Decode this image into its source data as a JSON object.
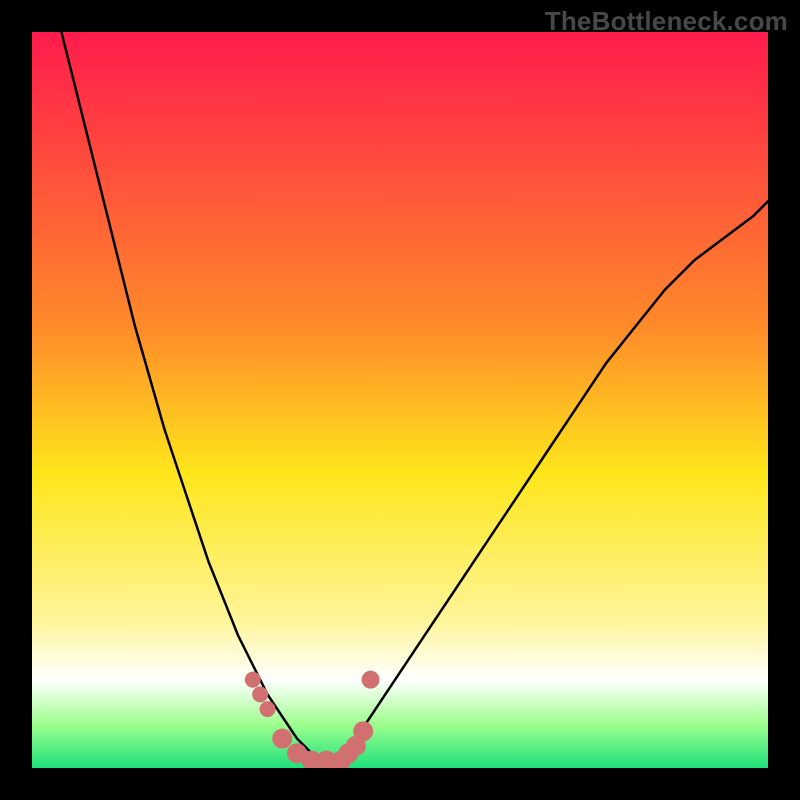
{
  "watermark": "TheBottleneck.com",
  "chart_data": {
    "type": "line",
    "title": "",
    "xlabel": "",
    "ylabel": "",
    "xlim": [
      0,
      100
    ],
    "ylim": [
      0,
      100
    ],
    "grid": false,
    "legend": false,
    "background_gradient": {
      "stops": [
        {
          "pos": 0.0,
          "color": "#ff1b4c"
        },
        {
          "pos": 0.4,
          "color": "#ff8a2a"
        },
        {
          "pos": 0.6,
          "color": "#ffe61b"
        },
        {
          "pos": 0.8,
          "color": "#fff59a"
        },
        {
          "pos": 0.88,
          "color": "#ffffff"
        },
        {
          "pos": 0.94,
          "color": "#9fff8f"
        },
        {
          "pos": 1.0,
          "color": "#1ee07a"
        }
      ]
    },
    "series": [
      {
        "name": "curve-left",
        "x": [
          4,
          6,
          8,
          10,
          12,
          14,
          16,
          18,
          20,
          22,
          24,
          26,
          28,
          30,
          32,
          34,
          36,
          38
        ],
        "y": [
          100,
          92,
          84,
          76,
          68,
          60,
          53,
          46,
          40,
          34,
          28,
          23,
          18,
          14,
          10,
          7,
          4,
          2
        ],
        "stroke": "#000000",
        "width": 2.5
      },
      {
        "name": "curve-right",
        "x": [
          42,
          44,
          46,
          50,
          54,
          58,
          62,
          66,
          70,
          74,
          78,
          82,
          86,
          90,
          94,
          98,
          100
        ],
        "y": [
          2,
          4,
          7,
          13,
          19,
          25,
          31,
          37,
          43,
          49,
          55,
          60,
          65,
          69,
          72,
          75,
          77
        ],
        "stroke": "#000000",
        "width": 2.5
      },
      {
        "name": "markers",
        "type": "scatter",
        "points": [
          {
            "x": 30,
            "y": 12,
            "r": 8
          },
          {
            "x": 31,
            "y": 10,
            "r": 8
          },
          {
            "x": 32,
            "y": 8,
            "r": 8
          },
          {
            "x": 34,
            "y": 4,
            "r": 10
          },
          {
            "x": 36,
            "y": 2,
            "r": 10
          },
          {
            "x": 38,
            "y": 1,
            "r": 10
          },
          {
            "x": 40,
            "y": 1,
            "r": 10
          },
          {
            "x": 42,
            "y": 1,
            "r": 10
          },
          {
            "x": 43,
            "y": 2,
            "r": 10
          },
          {
            "x": 44,
            "y": 3,
            "r": 10
          },
          {
            "x": 45,
            "y": 5,
            "r": 10
          },
          {
            "x": 46,
            "y": 12,
            "r": 9
          }
        ],
        "color": "#d07070"
      }
    ]
  }
}
